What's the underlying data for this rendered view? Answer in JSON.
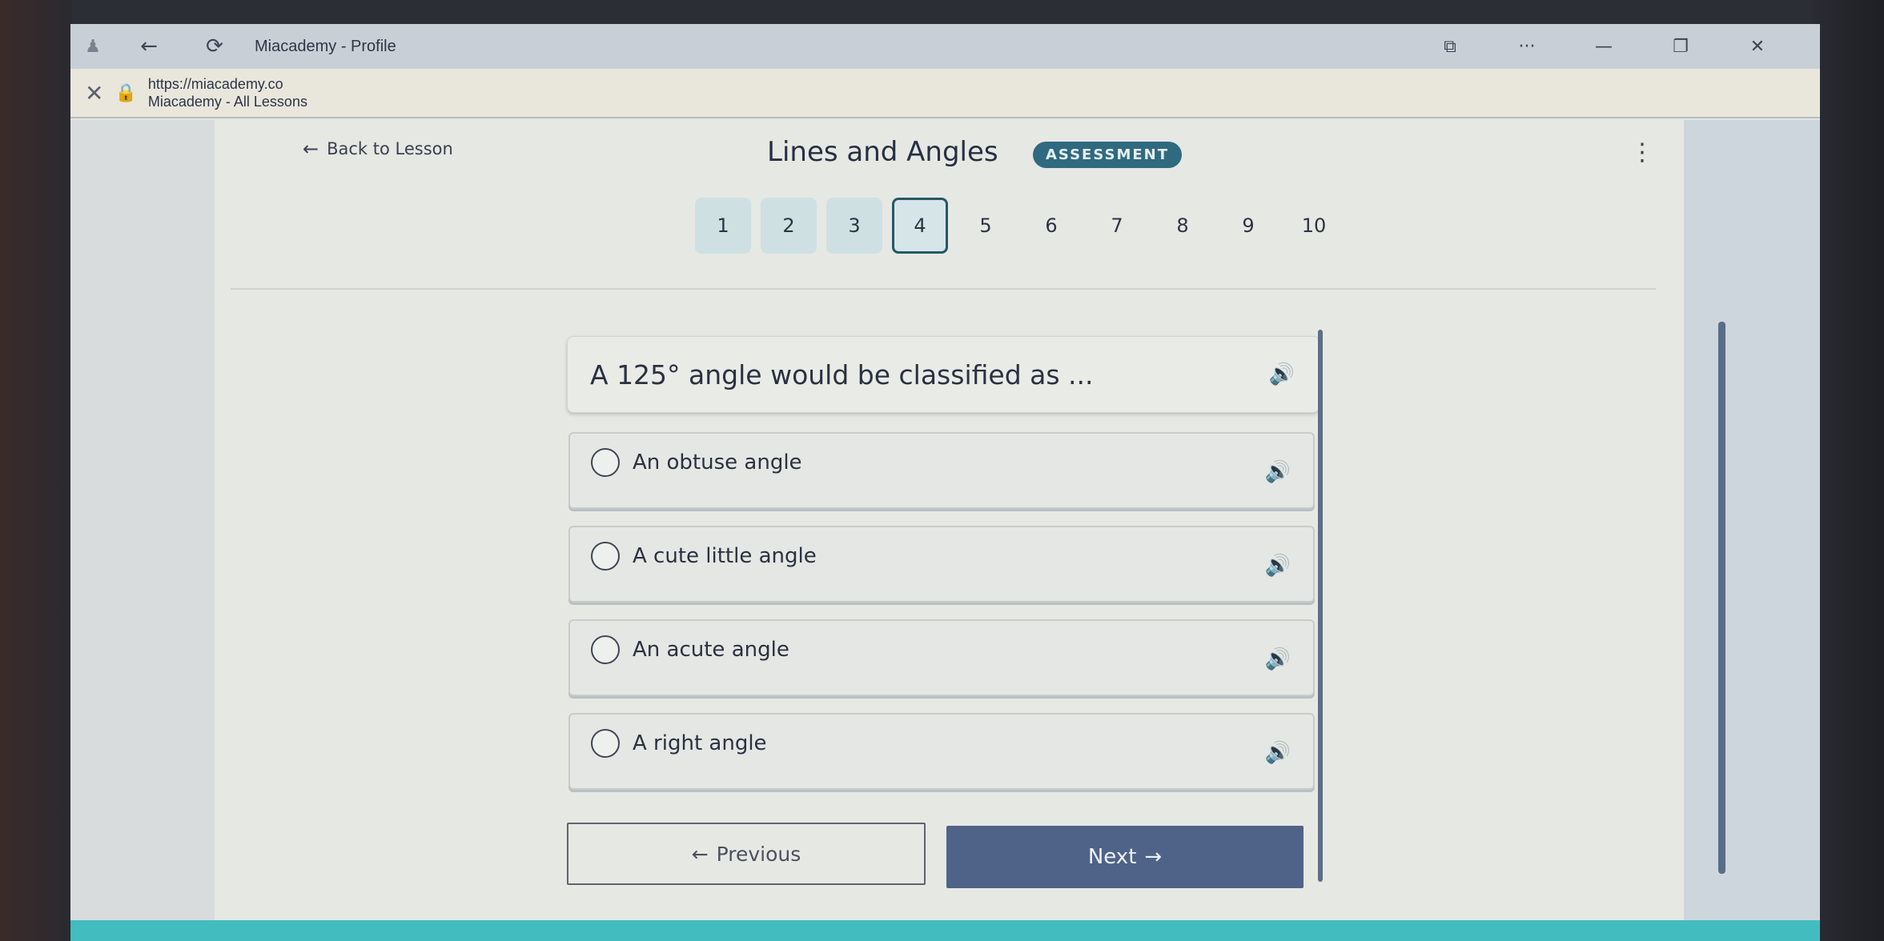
{
  "browser": {
    "tab_title": "Miacademy - Profile",
    "url": "https://miacademy.co",
    "page_title": "Miacademy - All Lessons",
    "icons": {
      "extension": "extension-icon",
      "back": "back-arrow-icon",
      "refresh": "refresh-icon",
      "close_tab": "close-icon",
      "lock": "lock-icon",
      "immersive_reader": "immersive-reader-icon",
      "more": "more-options-icon",
      "minimize": "minimize-icon",
      "restore": "restore-icon",
      "close_window": "close-icon"
    },
    "glyphs": {
      "extension": "♟",
      "back": "←",
      "refresh": "⟳",
      "close": "✕",
      "lock": "🔒",
      "reader": "⧉",
      "more": "···",
      "minimize": "—",
      "restore": "❐"
    }
  },
  "header": {
    "back_label": "Back to Lesson",
    "back_arrow": "←",
    "title": "Lines and Angles",
    "badge": "ASSESSMENT",
    "menu_glyph": "⋮"
  },
  "question_nav": {
    "current": 4,
    "items": [
      {
        "label": "1",
        "state": "done"
      },
      {
        "label": "2",
        "state": "done"
      },
      {
        "label": "3",
        "state": "done"
      },
      {
        "label": "4",
        "state": "current"
      },
      {
        "label": "5",
        "state": "plain"
      },
      {
        "label": "6",
        "state": "plain"
      },
      {
        "label": "7",
        "state": "plain"
      },
      {
        "label": "8",
        "state": "plain"
      },
      {
        "label": "9",
        "state": "plain"
      },
      {
        "label": "10",
        "state": "plain"
      }
    ]
  },
  "question": {
    "text": "A 125° angle would be classified as ...",
    "speaker_glyph": "🔊"
  },
  "options": [
    {
      "label": "An obtuse angle"
    },
    {
      "label": "A cute little angle"
    },
    {
      "label": "An acute angle"
    },
    {
      "label": "A right angle"
    }
  ],
  "footer": {
    "previous_label": "Previous",
    "previous_arrow": "←",
    "next_label": "Next",
    "next_arrow": "→"
  },
  "colors": {
    "badge": "#2f6a80",
    "next_button": "#4f6388",
    "speaker": "#5d8fd6",
    "footer_bar": "#43bcc0"
  }
}
